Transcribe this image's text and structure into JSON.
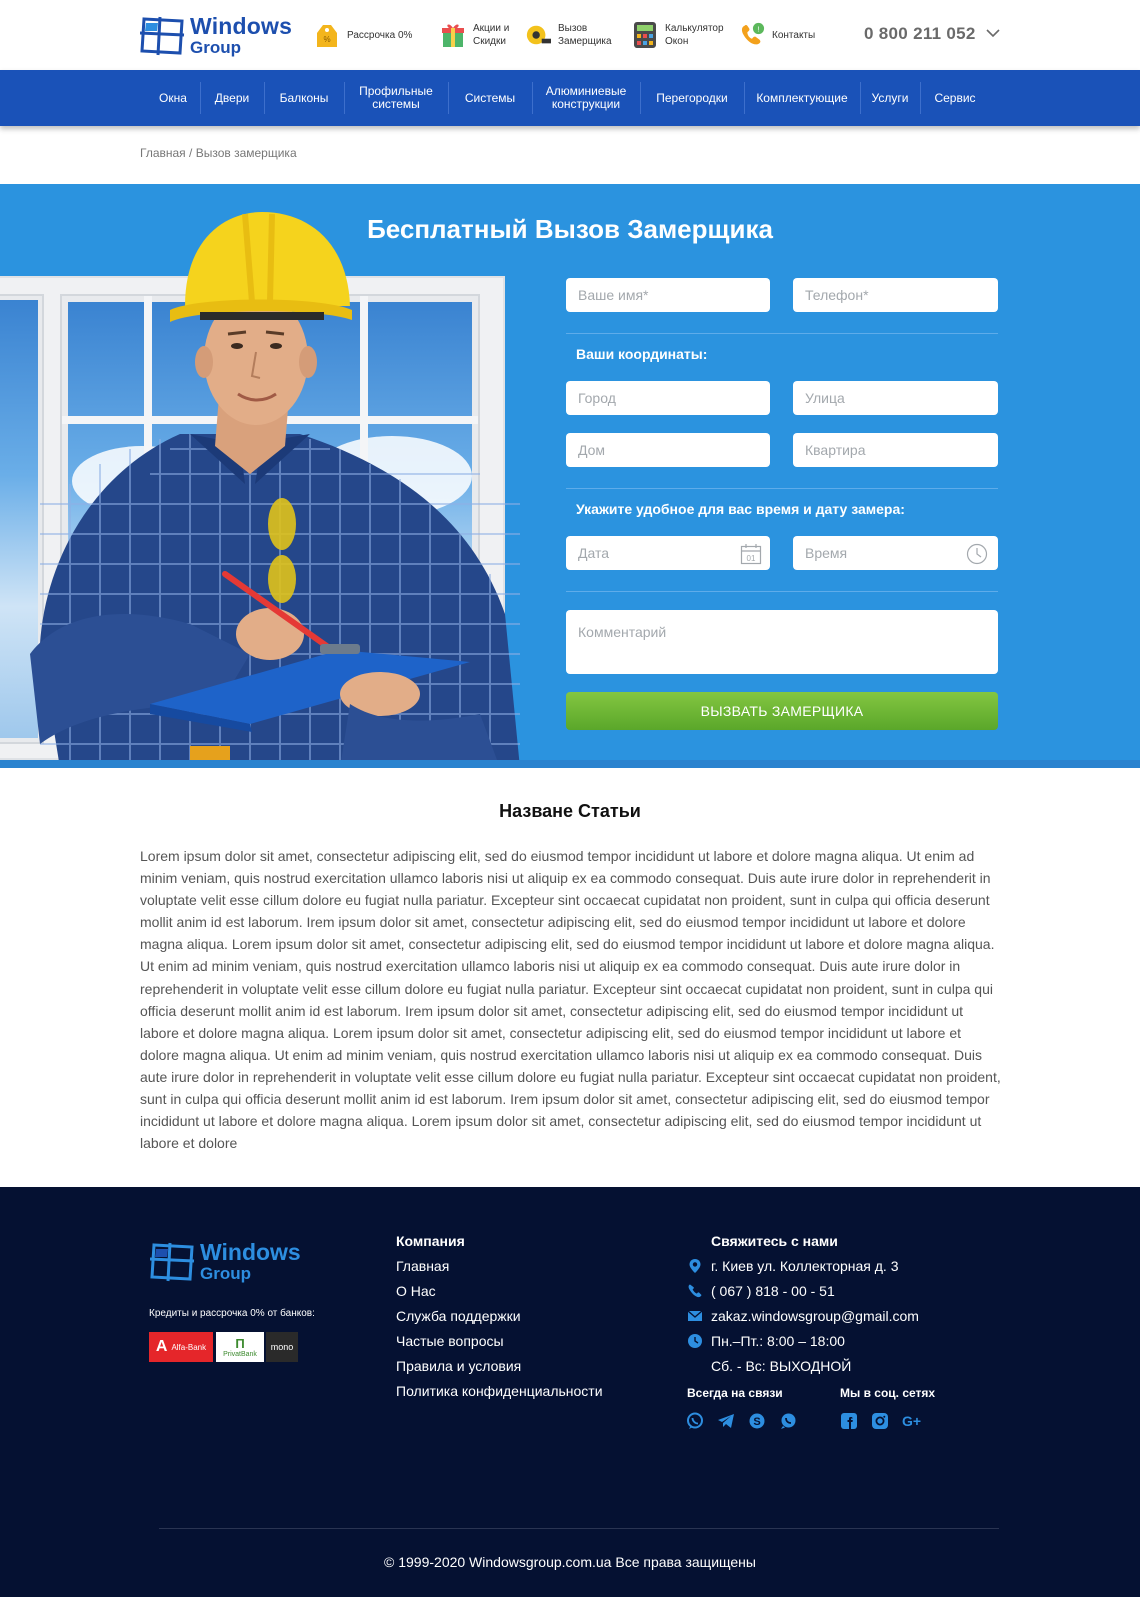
{
  "colors": {
    "brand_blue": "#1d4fae",
    "nav_blue": "#1a52b8",
    "hero_blue": "#2b93df",
    "submit_green": "#6bb535",
    "footer_navy": "#051132",
    "footer_accent": "#2d8ee0"
  },
  "header": {
    "logo_line1": "Windows",
    "logo_line2": "Group",
    "items": [
      {
        "icon": "price-tag-icon",
        "line1": "Рассрочка 0%",
        "line2": ""
      },
      {
        "icon": "gift-icon",
        "line1": "Акции и",
        "line2": "Скидки"
      },
      {
        "icon": "tape-measure-icon",
        "line1": "Вызов",
        "line2": "Замерщика"
      },
      {
        "icon": "calculator-icon",
        "line1": "Калькулятор",
        "line2": "Окон"
      },
      {
        "icon": "phone-icon",
        "line1": "Контакты",
        "line2": ""
      }
    ],
    "phone": "0 800 211 052"
  },
  "nav": {
    "items": [
      {
        "line1": "Окна",
        "line2": ""
      },
      {
        "line1": "Двери",
        "line2": ""
      },
      {
        "line1": "Балконы",
        "line2": ""
      },
      {
        "line1": "Профильные",
        "line2": "системы"
      },
      {
        "line1": "Системы",
        "line2": ""
      },
      {
        "line1": "Алюминиевые",
        "line2": "конструкции"
      },
      {
        "line1": "Перегородки",
        "line2": ""
      },
      {
        "line1": "Комплектующие",
        "line2": ""
      },
      {
        "line1": "Услуги",
        "line2": ""
      },
      {
        "line1": "Сервис",
        "line2": ""
      }
    ]
  },
  "breadcrumb": {
    "home": "Главная",
    "separator": " / ",
    "current": "Вызов замерщика"
  },
  "hero": {
    "title": "Бесплатный Вызов Замерщика"
  },
  "form": {
    "name_placeholder": "Ваше имя*",
    "phone_placeholder": "Телефон*",
    "coords_label": "Ваши координаты:",
    "city_placeholder": "Город",
    "street_placeholder": "Улица",
    "house_placeholder": "Дом",
    "apartment_placeholder": "Квартира",
    "datetime_label": "Укажите удобное для вас время и дату замера:",
    "date_placeholder": "Дата",
    "calendar_day": "01",
    "time_placeholder": "Время",
    "comment_placeholder": "Комментарий",
    "submit_label": "ВЫЗВАТЬ ЗАМЕРЩИКА"
  },
  "article": {
    "title": "Назване Статьи",
    "body": "Lorem ipsum dolor sit amet, consectetur adipiscing elit, sed do eiusmod tempor incididunt ut labore et dolore magna aliqua. Ut enim ad minim veniam, quis nostrud exercitation ullamco laboris nisi ut aliquip ex ea commodo consequat. Duis aute irure dolor in reprehenderit in voluptate velit esse cillum dolore eu fugiat nulla pariatur. Excepteur sint occaecat cupidatat non proident, sunt in culpa qui officia deserunt mollit anim id est laborum. Irem ipsum dolor sit amet, consectetur adipiscing elit, sed do eiusmod tempor incididunt ut labore et dolore magna aliqua. Lorem ipsum dolor sit amet, consectetur adipiscing elit, sed do eiusmod tempor incididunt ut labore et dolore magna aliqua. Ut enim ad minim veniam, quis nostrud exercitation ullamco laboris nisi ut aliquip ex ea commodo consequat. Duis aute irure dolor in reprehenderit in voluptate velit esse cillum dolore eu fugiat nulla pariatur. Excepteur sint occaecat cupidatat non proident, sunt in culpa qui officia deserunt mollit anim id est laborum. Irem ipsum dolor sit amet, consectetur adipiscing elit, sed do eiusmod tempor incididunt ut labore et dolore magna aliqua. Lorem ipsum dolor sit amet, consectetur adipiscing elit, sed do eiusmod tempor incididunt ut labore et dolore magna aliqua. Ut enim ad minim veniam, quis nostrud exercitation ullamco laboris nisi ut aliquip ex ea commodo consequat. Duis aute irure dolor in reprehenderit in voluptate velit esse cillum dolore eu fugiat nulla pariatur. Excepteur sint occaecat cupidatat non proident, sunt in culpa qui officia deserunt mollit anim id est laborum. Irem ipsum dolor sit amet, consectetur adipiscing elit, sed do eiusmod tempor incididunt ut labore et dolore magna aliqua. Lorem ipsum dolor sit amet, consectetur adipiscing elit, sed do eiusmod tempor incididunt ut labore et dolore"
  },
  "footer": {
    "logo_line1": "Windows",
    "logo_line2": "Group",
    "credit_text": "Кредиты и рассрочка  0% от банков:",
    "banks": [
      "Alfa-Bank",
      "PrivatBank",
      "mono"
    ],
    "company_title": "Компания",
    "company_links": [
      "Главная",
      "О Нас",
      "Служба поддержки",
      "Частые вопросы",
      "Правила и условия",
      "Политика конфиденциальности"
    ],
    "contact_title": "Свяжитесь с нами",
    "address": "г. Киев  ул. Коллекторная д. 3",
    "phone": "( 067 ) 818 - 00 - 51",
    "email": "zakaz.windowsgroup@gmail.com",
    "hours_weekdays": "Пн.–Пт.: 8:00 – 18:00",
    "hours_weekend": "Сб. - Вс: ВЫХОДНОЙ",
    "always_title": "Всегда на связи",
    "messengers": [
      "viber-icon",
      "telegram-icon",
      "skype-icon",
      "whatsapp-icon"
    ],
    "social_title": "Мы в соц. сетях",
    "socials": [
      "facebook-icon",
      "instagram-icon",
      "google-plus-icon"
    ],
    "copyright": "© 1999-2020 Windowsgroup.com.ua Все права защищены"
  }
}
